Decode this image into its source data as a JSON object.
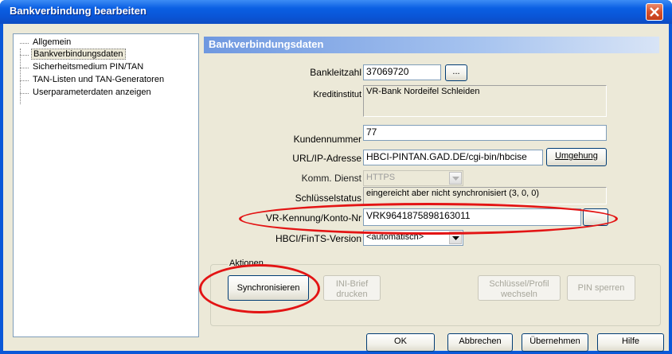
{
  "window": {
    "title": "Bankverbindung bearbeiten"
  },
  "tree": {
    "items": [
      {
        "label": "Allgemein"
      },
      {
        "label": "Bankverbindungsdaten"
      },
      {
        "label": "Sicherheitsmedium PIN/TAN"
      },
      {
        "label": "TAN-Listen und TAN-Generatoren"
      },
      {
        "label": "Userparameterdaten anzeigen"
      }
    ]
  },
  "section": {
    "title": "Bankverbindungsdaten"
  },
  "form": {
    "bankleitzahl": {
      "label": "Bankleitzahl",
      "value": "37069720",
      "browse": "..."
    },
    "kreditinstitut": {
      "label": "Kreditinstitut",
      "value": "VR-Bank Nordeifel Schleiden"
    },
    "kundennummer": {
      "label": "Kundennummer",
      "value": "77"
    },
    "url": {
      "label": "URL/IP-Adresse",
      "value": "HBCI-PINTAN.GAD.DE/cgi-bin/hbcise",
      "button": "Umgehung"
    },
    "komm": {
      "label": "Komm. Dienst",
      "value": "HTTPS"
    },
    "schluesselstatus": {
      "label": "Schlüsselstatus",
      "value": "eingereicht aber nicht synchronisiert (3, 0, 0)"
    },
    "kennung": {
      "label": "VR-Kennung/Konto-Nr",
      "value": "VRK9641875898163011"
    },
    "version": {
      "label": "HBCI/FinTS-Version",
      "value": "<automatisch>"
    }
  },
  "actions": {
    "title": "Aktionen",
    "synchronisieren": "Synchronisieren",
    "ini_brief_1": "INI-Brief",
    "ini_brief_2": "drucken",
    "schluessel_1": "Schlüssel/Profil",
    "schluessel_2": "wechseln",
    "pin_sperren": "PIN sperren"
  },
  "footer": {
    "ok": "OK",
    "abbrechen": "Abbrechen",
    "uebernehmen": "Übernehmen",
    "hilfe": "Hilfe"
  },
  "colors": {
    "titlebar": "#0a55d6",
    "client": "#ece9d8",
    "annotation": "#e31414"
  }
}
